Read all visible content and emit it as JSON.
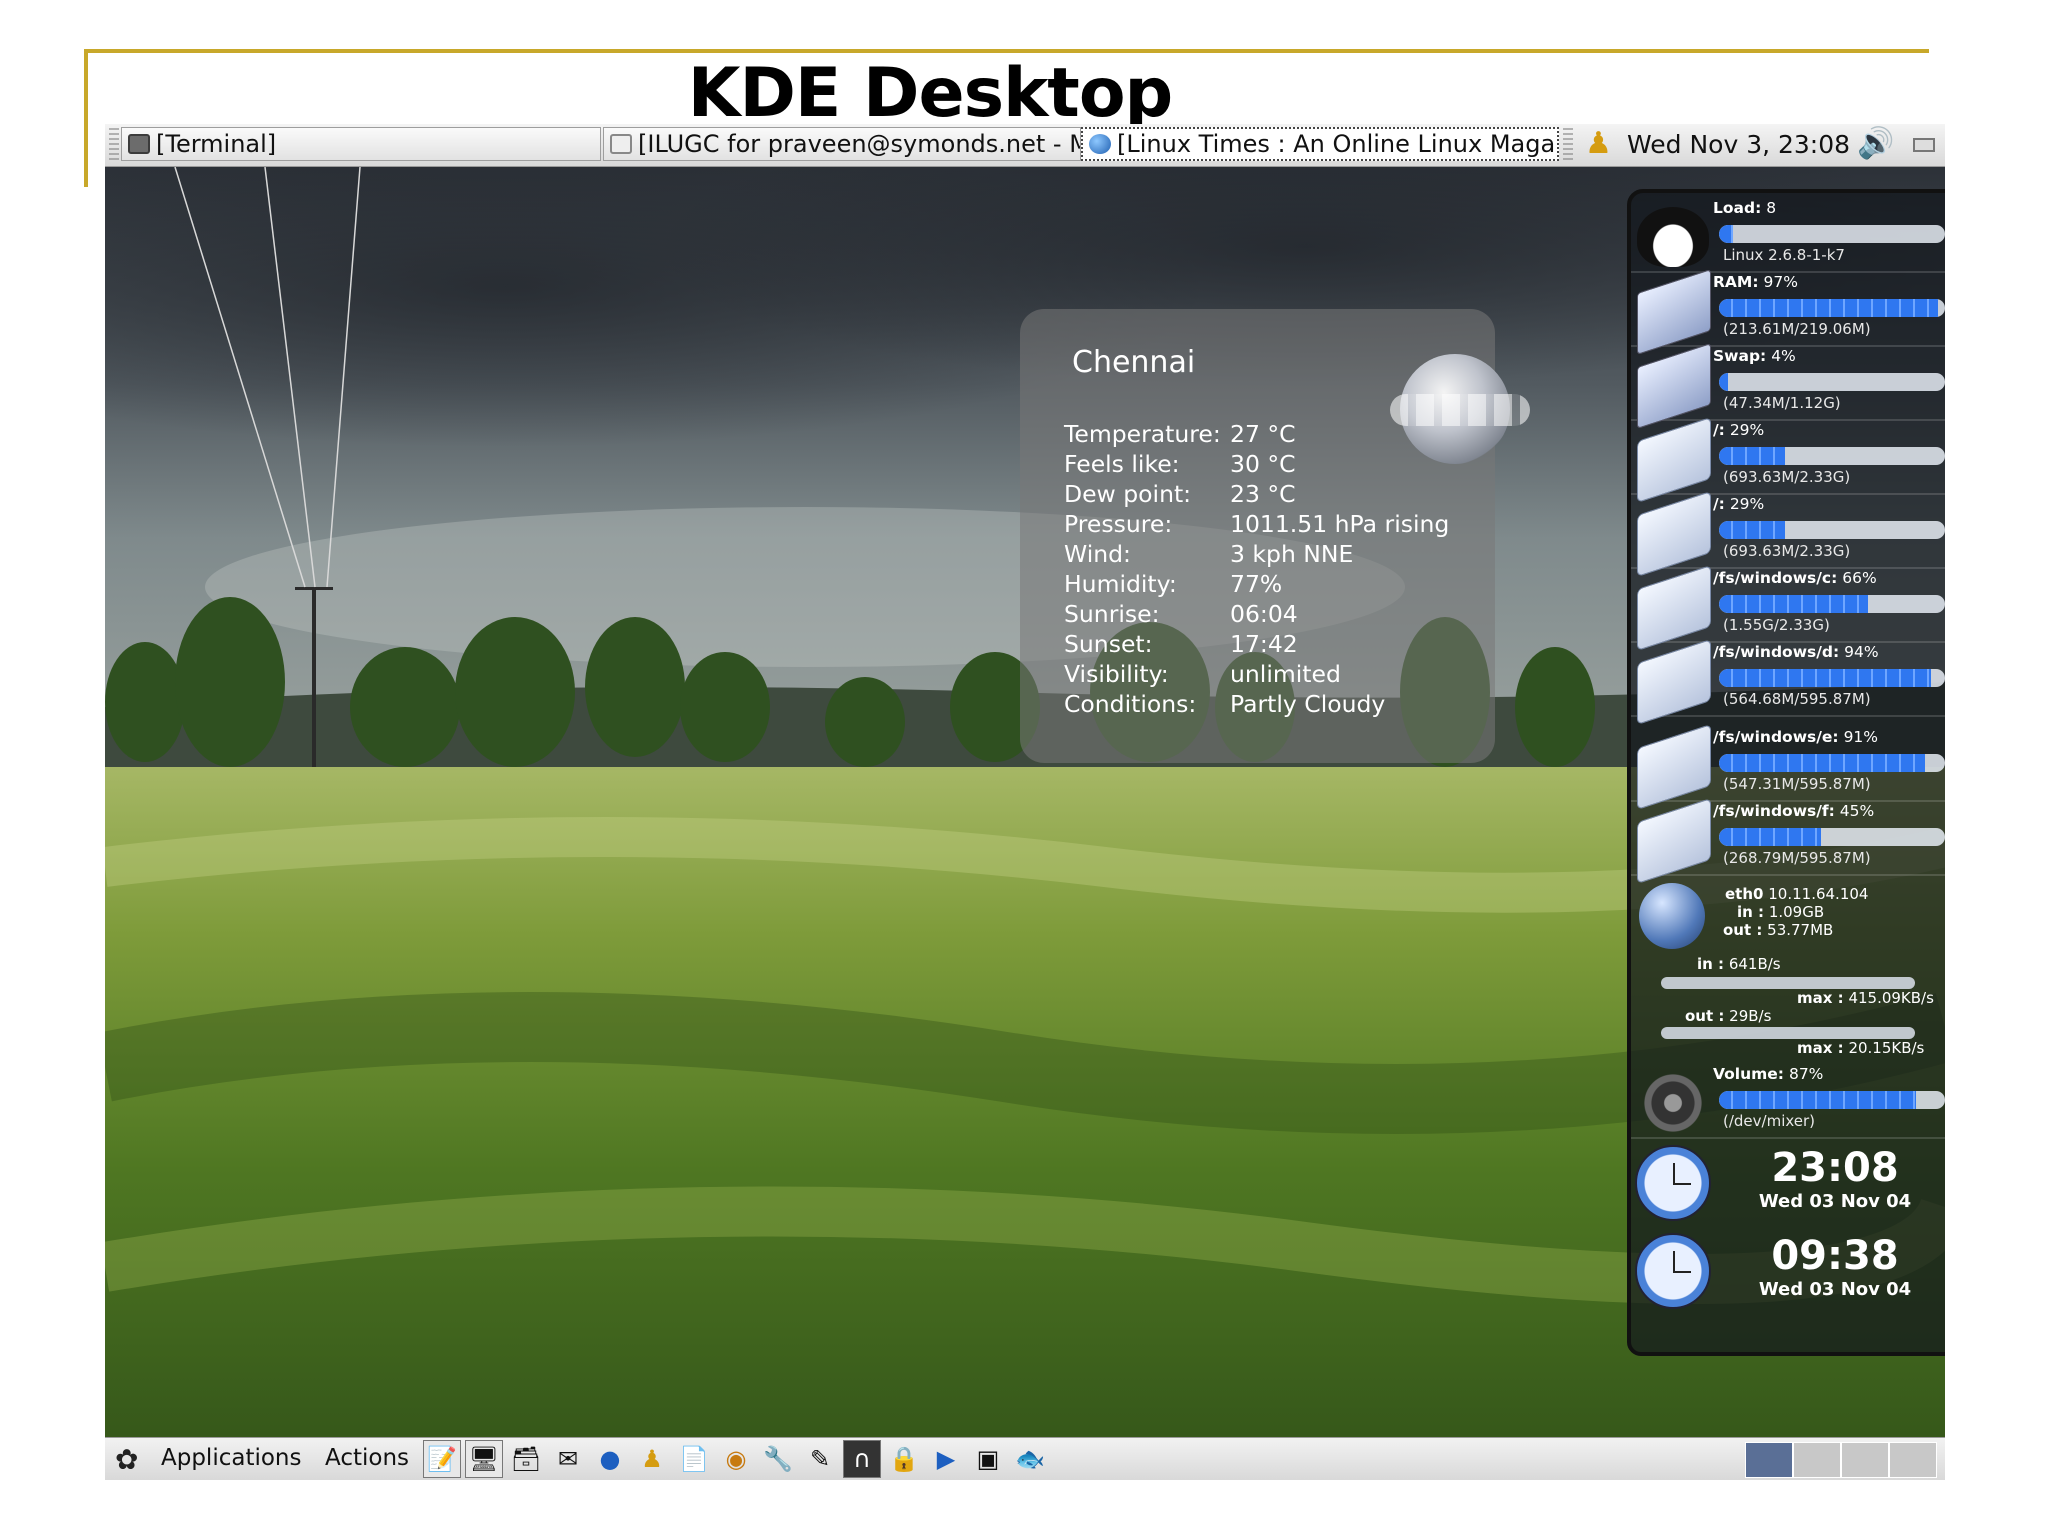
{
  "slide": {
    "title": "KDE Desktop"
  },
  "top_panel": {
    "tasks": [
      {
        "icon": "terminal-icon",
        "label": "[Terminal]"
      },
      {
        "icon": "mail-icon",
        "label": "[ILUGC for praveen@symonds.net - M"
      },
      {
        "icon": "globe-icon",
        "label": "[Linux Times : An Online Linux Maga:"
      }
    ],
    "clock": "Wed Nov  3, 23:08"
  },
  "weather": {
    "city": "Chennai",
    "rows": [
      {
        "label": "Temperature:",
        "value": "27 °C"
      },
      {
        "label": "Feels like:",
        "value": "30 °C"
      },
      {
        "label": "Dew point:",
        "value": "23 °C"
      },
      {
        "label": "Pressure:",
        "value": "1011.51 hPa rising"
      },
      {
        "label": "Wind:",
        "value": "3 kph NNE"
      },
      {
        "label": "Humidity:",
        "value": "77%"
      },
      {
        "label": "Sunrise:",
        "value": "06:04"
      },
      {
        "label": "Sunset:",
        "value": "17:42"
      },
      {
        "label": "Visibility:",
        "value": "unlimited"
      },
      {
        "label": "Conditions:",
        "value": "Partly Cloudy"
      }
    ]
  },
  "monitor": {
    "load": {
      "name": "Load:",
      "value": "8",
      "sub": "Linux 2.6.8-1-k7",
      "level": 0.06
    },
    "ram": {
      "name": "RAM:",
      "value": "97%",
      "sub": "(213.61M/219.06M)",
      "level": 0.97
    },
    "swap": {
      "name": "Swap:",
      "value": "4%",
      "sub": "(47.34M/1.12G)",
      "level": 0.04
    },
    "root1": {
      "name": "/:",
      "value": "29%",
      "sub": "(693.63M/2.33G)",
      "level": 0.29
    },
    "root2": {
      "name": "/:",
      "value": "29%",
      "sub": "(693.63M/2.33G)",
      "level": 0.29
    },
    "win_c": {
      "name": "/fs/windows/c:",
      "value": "66%",
      "sub": "(1.55G/2.33G)",
      "level": 0.66
    },
    "win_d": {
      "name": "/fs/windows/d:",
      "value": "94%",
      "sub": "(564.68M/595.87M)",
      "level": 0.94
    },
    "win_e": {
      "name": "/fs/windows/e:",
      "value": "91%",
      "sub": "(547.31M/595.87M)",
      "level": 0.91
    },
    "win_f": {
      "name": "/fs/windows/f:",
      "value": "45%",
      "sub": "(268.79M/595.87M)",
      "level": 0.45
    },
    "net": {
      "iface": "eth0",
      "ip": "10.11.64.104",
      "in_total_label": "in :",
      "in_total": "1.09GB",
      "out_total_label": "out :",
      "out_total": "53.77MB",
      "in_rate_label": "in :",
      "in_rate": "641B/s",
      "in_max_label": "max :",
      "in_max": "415.09KB/s",
      "out_rate_label": "out :",
      "out_rate": "29B/s",
      "out_max_label": "max :",
      "out_max": "20.15KB/s"
    },
    "volume": {
      "name": "Volume:",
      "value": "87%",
      "sub": "(/dev/mixer)",
      "level": 0.87
    },
    "clocks": [
      {
        "time": "23:08",
        "date": "Wed 03 Nov 04"
      },
      {
        "time": "09:38",
        "date": "Wed 03 Nov 04"
      }
    ]
  },
  "bottom_panel": {
    "applications": "Applications",
    "actions": "Actions",
    "launchers": [
      "notes-icon",
      "monitor-icon",
      "files-icon",
      "mail-icon",
      "globe-icon",
      "person-icon",
      "document-icon",
      "eye-icon",
      "tools-icon",
      "pen-icon",
      "arch-icon",
      "lock-icon",
      "play-icon",
      "box-icon",
      "fish-icon"
    ],
    "workspaces": 4,
    "active_workspace": 1
  }
}
